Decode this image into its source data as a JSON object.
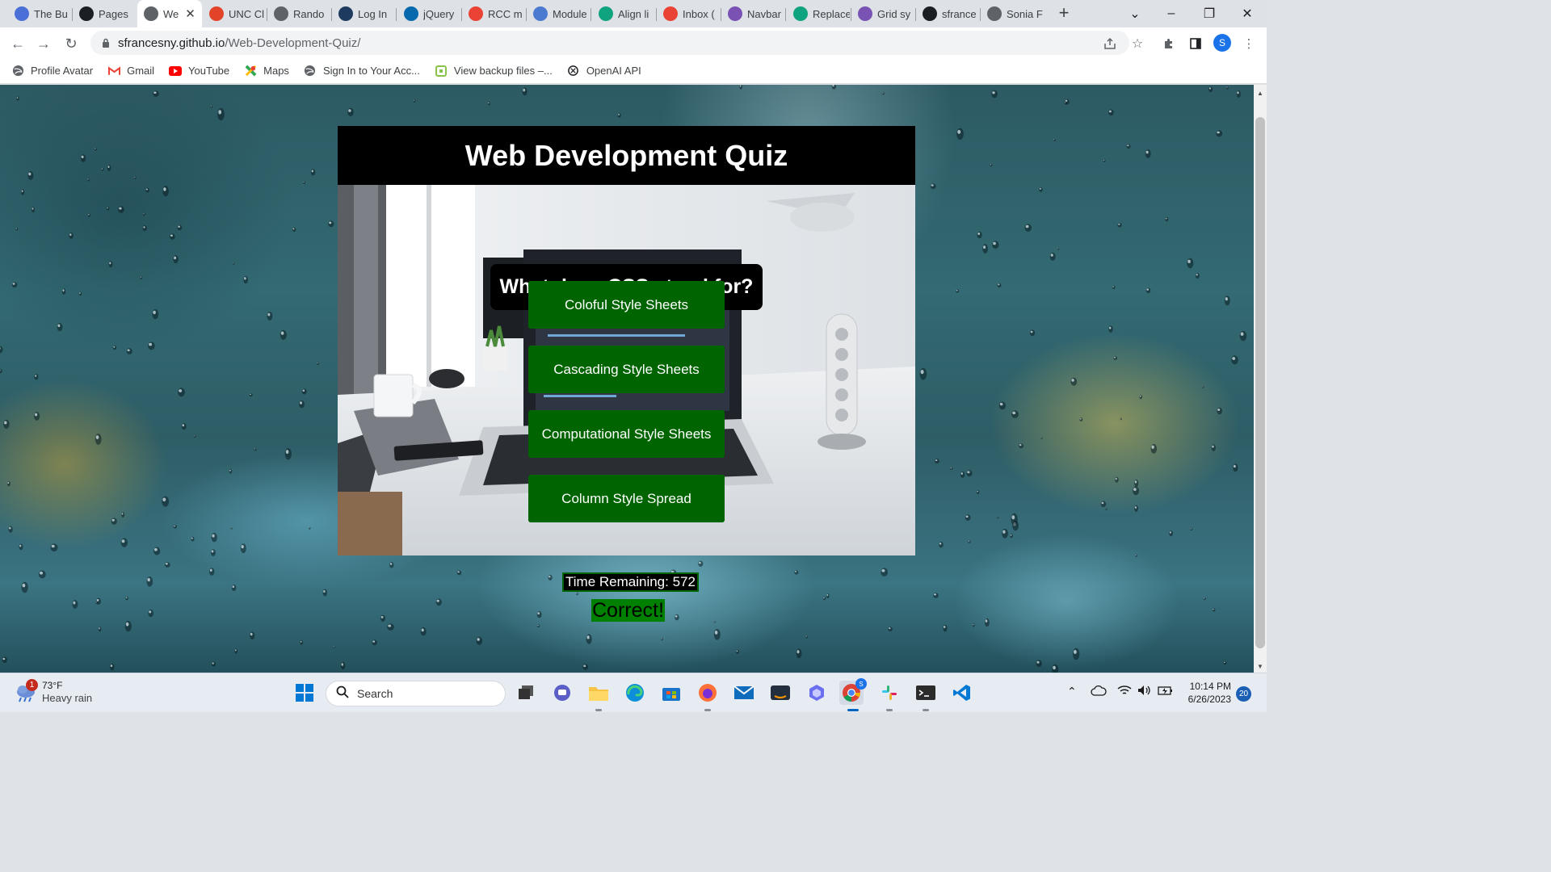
{
  "browser": {
    "tabs": [
      {
        "label": "The Bu",
        "icon": "blue-logo",
        "color": "#4a6fd6"
      },
      {
        "label": "Pages",
        "icon": "github-logo",
        "color": "#1b1f23"
      },
      {
        "label": "We",
        "icon": "globe",
        "color": "#5f6368",
        "active": true
      },
      {
        "label": "UNC Cl",
        "icon": "gitlab-logo",
        "color": "#e24329"
      },
      {
        "label": "Rando",
        "icon": "globe",
        "color": "#5f6368"
      },
      {
        "label": "Log In",
        "icon": "fsa-logo",
        "color": "#1e3a5f"
      },
      {
        "label": "jQuery",
        "icon": "jquery-logo",
        "color": "#0769ad"
      },
      {
        "label": "RCC m",
        "icon": "gmail-logo",
        "color": "#ea4335"
      },
      {
        "label": "Module",
        "icon": "doc-logo",
        "color": "#4a7bd0"
      },
      {
        "label": "Align li",
        "icon": "openai-logo",
        "color": "#10a37f"
      },
      {
        "label": "Inbox (",
        "icon": "gmail-logo",
        "color": "#ea4335"
      },
      {
        "label": "Navbar",
        "icon": "bootstrap-logo",
        "color": "#7952b3"
      },
      {
        "label": "Replace",
        "icon": "openai-logo",
        "color": "#10a37f"
      },
      {
        "label": "Grid sy",
        "icon": "bootstrap-logo",
        "color": "#7952b3"
      },
      {
        "label": "sfrance",
        "icon": "github-logo",
        "color": "#1b1f23"
      },
      {
        "label": "Sonia F",
        "icon": "globe",
        "color": "#5f6368"
      }
    ],
    "url_domain": "sfrancesny.github.io",
    "url_path": "/Web-Development-Quiz/",
    "profile_initial": "S",
    "bookmarks": [
      {
        "label": "Profile Avatar",
        "icon": "globe",
        "color": "#5f6368"
      },
      {
        "label": "Gmail",
        "icon": "gmail-logo",
        "color": "#ea4335"
      },
      {
        "label": "YouTube",
        "icon": "youtube-logo",
        "color": "#ff0000"
      },
      {
        "label": "Maps",
        "icon": "maps-logo",
        "color": "#34a853"
      },
      {
        "label": "Sign In to Your Acc...",
        "icon": "globe",
        "color": "#5f6368"
      },
      {
        "label": "View backup files –...",
        "icon": "backup-logo",
        "color": "#8bc34a"
      },
      {
        "label": "OpenAI API",
        "icon": "openai-logo",
        "color": "#202124"
      }
    ]
  },
  "quiz": {
    "title": "Web Development Quiz",
    "question": "What does CSS stand for?",
    "answers": [
      "Coloful Style Sheets",
      "Cascading Style Sheets",
      "Computational Style Sheets",
      "Column Style Spread"
    ],
    "timer_label": "Time Remaining: 572",
    "feedback": "Correct!"
  },
  "taskbar": {
    "weather_temp": "73°F",
    "weather_condition": "Heavy rain",
    "weather_badge": "1",
    "search_placeholder": "Search",
    "time": "10:14 PM",
    "date": "6/26/2023",
    "notification_count": "20",
    "chrome_badge": "S"
  }
}
